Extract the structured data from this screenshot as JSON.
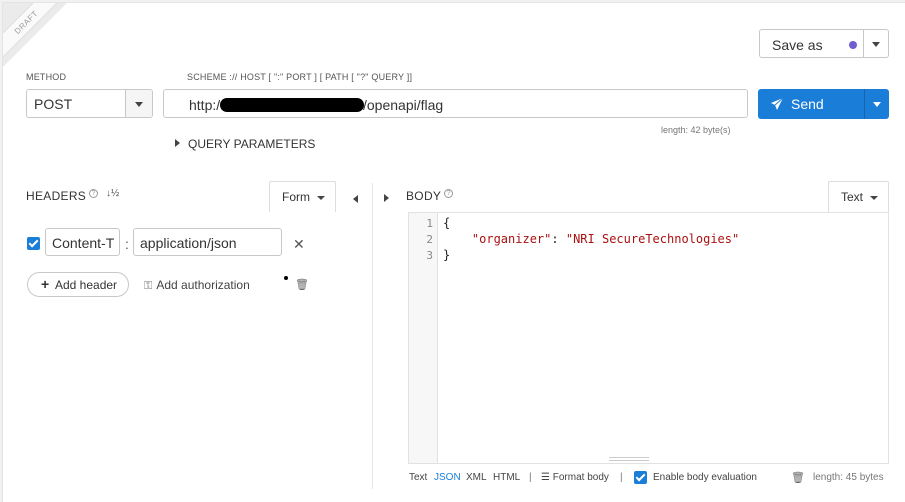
{
  "draft_label": "DRAFT",
  "method": {
    "label": "METHOD",
    "value": "POST"
  },
  "url": {
    "label": "SCHEME :// HOST [ \":\" PORT ] [ PATH [ \"?\" QUERY ]]",
    "prefix": "http:/",
    "suffix": "/openapi/flag",
    "length_note": "length: 42 byte(s)"
  },
  "send": {
    "label": "Send",
    "color": "#1a7ed8"
  },
  "save": {
    "label": "Save as",
    "dot_color": "#6e5fcf"
  },
  "query_parameters": "QUERY PARAMETERS",
  "headers": {
    "title": "HEADERS",
    "sort_icon": "sort-numeric-icon",
    "mode": "Form",
    "rows": [
      {
        "enabled": true,
        "name": "Content-T",
        "value": "application/json"
      }
    ],
    "add_header": "Add header",
    "add_authorization": "Add authorization"
  },
  "body": {
    "title": "BODY",
    "mode": "Text",
    "lines": [
      {
        "n": "1",
        "text": "{"
      },
      {
        "n": "2",
        "key": "\"organizer\"",
        "sep": ": ",
        "value": "\"NRI SecureTechnologies\""
      },
      {
        "n": "3",
        "text": "}"
      }
    ],
    "footer": {
      "formats": [
        "Text",
        "JSON",
        "XML",
        "HTML"
      ],
      "active_format": "JSON",
      "format_body": "Format body",
      "enable_eval": "Enable body evaluation",
      "length": "length: 45 bytes"
    }
  }
}
